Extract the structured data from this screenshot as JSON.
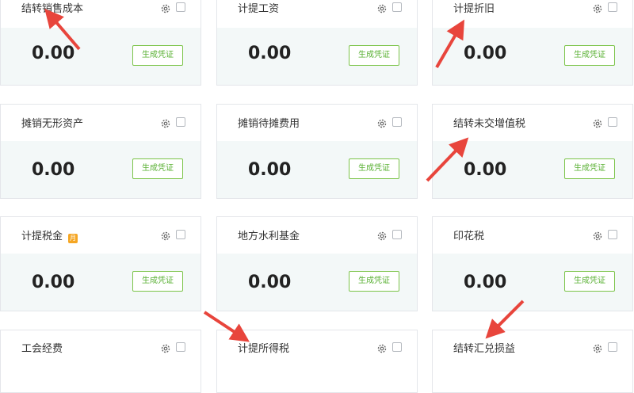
{
  "cards": [
    {
      "title": "结转销售成本",
      "amount": "0.00",
      "button": "生成凭证"
    },
    {
      "title": "计提工资",
      "amount": "0.00",
      "button": "生成凭证"
    },
    {
      "title": "计提折旧",
      "amount": "0.00",
      "button": "生成凭证"
    },
    {
      "title": "摊销无形资产",
      "amount": "0.00",
      "button": "生成凭证"
    },
    {
      "title": "摊销待摊费用",
      "amount": "0.00",
      "button": "生成凭证"
    },
    {
      "title": "结转未交增值税",
      "amount": "0.00",
      "button": "生成凭证"
    },
    {
      "title": "计提税金",
      "amount": "0.00",
      "button": "生成凭证",
      "badge": "月"
    },
    {
      "title": "地方水利基金",
      "amount": "0.00",
      "button": "生成凭证"
    },
    {
      "title": "印花税",
      "amount": "0.00",
      "button": "生成凭证"
    },
    {
      "title": "工会经费"
    },
    {
      "title": "计提所得税"
    },
    {
      "title": "结转汇兑损益"
    }
  ],
  "colors": {
    "accent_green": "#58b032",
    "arrow_red": "#e8453c",
    "card_body_bg": "#f3f8f8"
  },
  "icons": {
    "settings": "gear-icon",
    "select": "checkbox"
  }
}
